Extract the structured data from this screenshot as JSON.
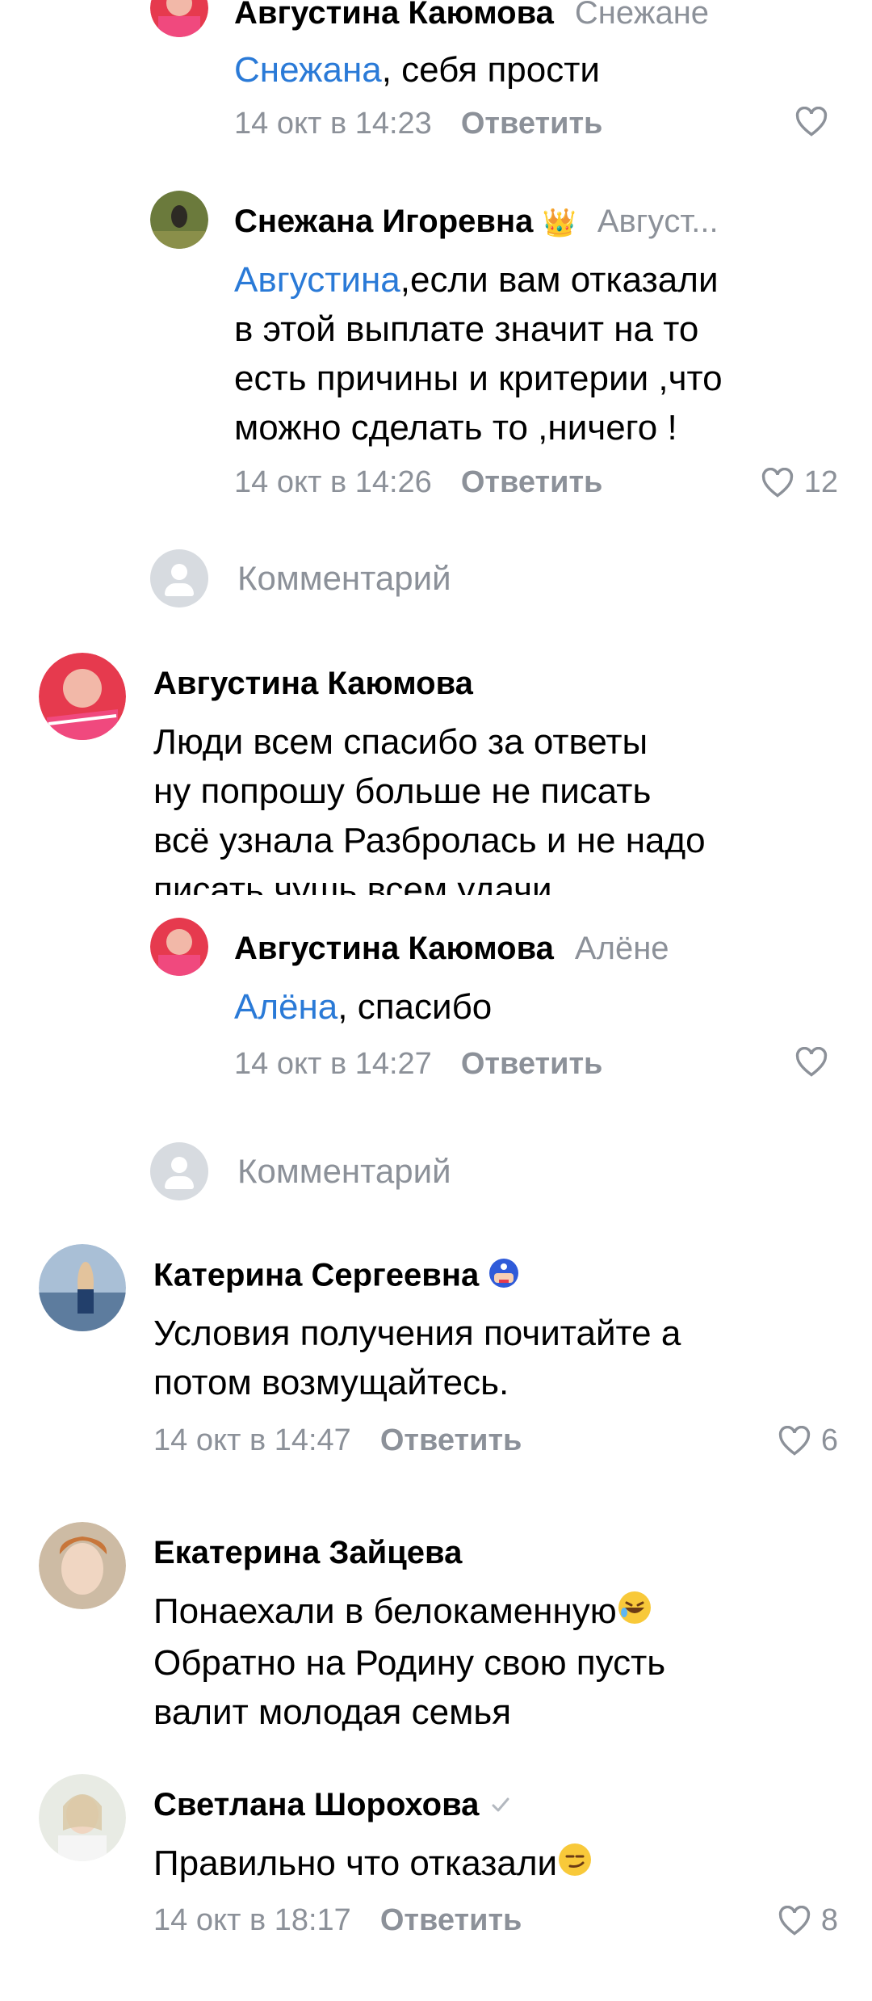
{
  "comments": [
    {
      "author": "Августина Каюмова",
      "reply_to": "Снежане",
      "mention": "Снежана",
      "text": ", себя  прости",
      "time": "14 окт в 14:23",
      "reply_label": "Ответить",
      "likes": ""
    },
    {
      "author": "Снежана Игоревна",
      "reply_to": "Авгуcт...",
      "mention": "Августина",
      "text_lines": [
        ",если вам отказали",
        "в этой выплате  значит на то",
        "есть причины и критерии ,что",
        "можно сделать то ,ничего !"
      ],
      "time": "14 окт в 14:26",
      "reply_label": "Ответить",
      "likes": "12"
    },
    {
      "comment_placeholder": "Комментарий"
    },
    {
      "author": "Августина Каюмова",
      "text_lines": [
        "Люди всем спасибо за ответы",
        "ну попрошу больше не писать",
        "всё узнала Разбролась и не надо",
        "писать чушь всем удачи"
      ]
    },
    {
      "author": "Августина Каюмова",
      "reply_to": "Алёне",
      "mention": "Алёна",
      "text": ", спасибо",
      "time": "14 окт в 14:27",
      "reply_label": "Ответить",
      "likes": ""
    },
    {
      "comment_placeholder": "Комментарий"
    },
    {
      "author": "Катерина Сергеевна",
      "text_lines": [
        "Условия получения почитайте а",
        "потом возмущайтесь."
      ],
      "time": "14 окт в 14:47",
      "reply_label": "Ответить",
      "likes": "6"
    },
    {
      "author": "Екатерина Зайцева",
      "text_lines": [
        "Понаехали в белокаменную",
        "Обратно на Родину свою пусть",
        "валит молодая семья"
      ]
    },
    {
      "author": "Светлана Шорохова",
      "text_lines": [
        "Правильно что отказали"
      ],
      "time": "14 окт в 18:17",
      "reply_label": "Ответить",
      "likes": "8"
    }
  ],
  "colors": {
    "mention": "#2a7ad7",
    "muted": "#8c9199",
    "text": "#000000"
  },
  "icons": {
    "like": "heart-outline-icon",
    "verified": "check-icon",
    "crown": "crown-icon",
    "captain_badge": "captain-america-icon",
    "rofl_emoji": "rofl-emoji-icon",
    "smirk_emoji": "smirk-emoji-icon"
  }
}
